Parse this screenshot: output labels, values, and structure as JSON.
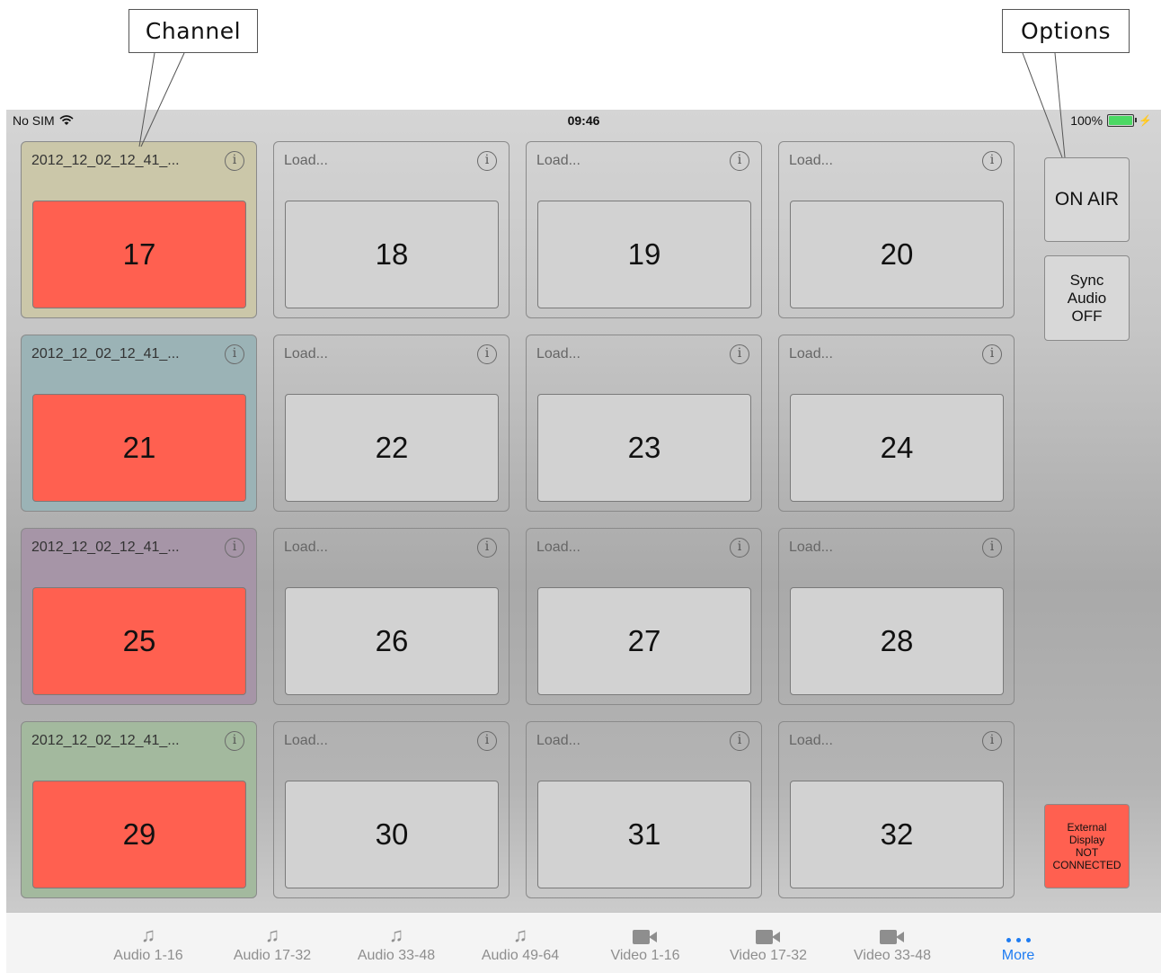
{
  "callouts": {
    "channel": "Channel",
    "options": "Options"
  },
  "status_bar": {
    "carrier": "No SIM",
    "time": "09:46",
    "battery": "100%",
    "wifi_icon": "wifi-icon",
    "battery_icon": "battery-icon"
  },
  "tiles": [
    {
      "title": "2012_12_02_12_41_...",
      "number": "17",
      "loaded": true,
      "color": "#cbc7a9"
    },
    {
      "title": "Load...",
      "number": "18",
      "loaded": false
    },
    {
      "title": "Load...",
      "number": "19",
      "loaded": false
    },
    {
      "title": "Load...",
      "number": "20",
      "loaded": false
    },
    {
      "title": "2012_12_02_12_41_...",
      "number": "21",
      "loaded": true,
      "color": "#9bb3b6"
    },
    {
      "title": "Load...",
      "number": "22",
      "loaded": false
    },
    {
      "title": "Load...",
      "number": "23",
      "loaded": false
    },
    {
      "title": "Load...",
      "number": "24",
      "loaded": false
    },
    {
      "title": "2012_12_02_12_41_...",
      "number": "25",
      "loaded": true,
      "color": "#a695a7"
    },
    {
      "title": "Load...",
      "number": "26",
      "loaded": false
    },
    {
      "title": "Load...",
      "number": "27",
      "loaded": false
    },
    {
      "title": "Load...",
      "number": "28",
      "loaded": false
    },
    {
      "title": "2012_12_02_12_41_...",
      "number": "29",
      "loaded": true,
      "color": "#a3b99e"
    },
    {
      "title": "Load...",
      "number": "30",
      "loaded": false
    },
    {
      "title": "Load...",
      "number": "31",
      "loaded": false
    },
    {
      "title": "Load...",
      "number": "32",
      "loaded": false
    }
  ],
  "info_glyph": "i",
  "options": {
    "on_air": "ON AIR",
    "sync_audio": "Sync\nAudio\nOFF",
    "external_display": "External\nDisplay\nNOT\nCONNECTED"
  },
  "tabs": [
    {
      "label": "Audio 1-16",
      "icon": "music-note-icon"
    },
    {
      "label": "Audio 17-32",
      "icon": "music-note-icon"
    },
    {
      "label": "Audio 33-48",
      "icon": "music-note-icon"
    },
    {
      "label": "Audio 49-64",
      "icon": "music-note-icon"
    },
    {
      "label": "Video 1-16",
      "icon": "video-camera-icon"
    },
    {
      "label": "Video 17-32",
      "icon": "video-camera-icon"
    },
    {
      "label": "Video 33-48",
      "icon": "video-camera-icon"
    },
    {
      "label": "More",
      "icon": "more-icon",
      "selected": true
    }
  ],
  "colors": {
    "active_button": "#ff6050",
    "selected_tab": "#1e7cf2"
  }
}
